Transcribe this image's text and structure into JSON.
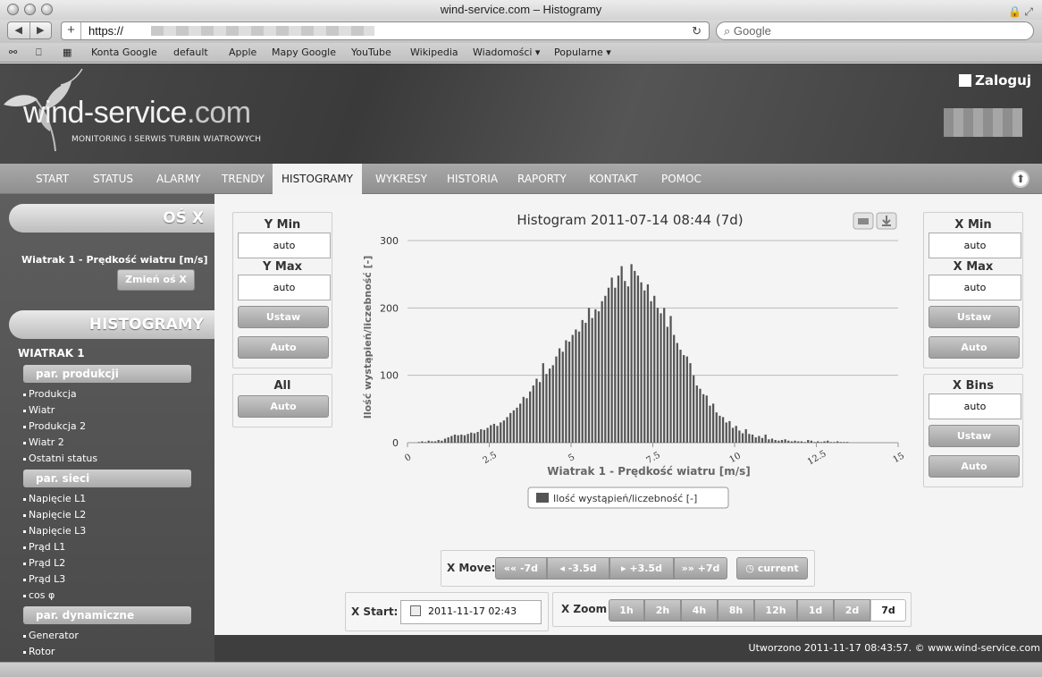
{
  "window": {
    "title": "wind-service.com – Histogramy"
  },
  "browser": {
    "url_prefix": "https://",
    "search_placeholder": "Google",
    "bookmarks": [
      "Konta Google",
      "default",
      "Apple",
      "Mapy Google",
      "YouTube",
      "Wikipedia",
      "Wiadomości ▾",
      "Popularne ▾"
    ]
  },
  "site": {
    "logo_main": "wind-service",
    "logo_tld": ".com",
    "tagline": "MONITORING I SERWIS TURBIN WIATROWYCH",
    "login": "Zaloguj"
  },
  "nav": {
    "items": [
      "START",
      "STATUS",
      "ALARMY",
      "TRENDY",
      "HISTOGRAMY",
      "WYKRESY",
      "HISTORIA",
      "RAPORTY",
      "KONTAKT",
      "POMOC"
    ],
    "active": "HISTOGRAMY"
  },
  "sidebar": {
    "axis_title": "OŚ X",
    "axis_value": "Wiatrak 1 - Prędkość wiatru [m/s]",
    "change_axis": "Zmień oś X",
    "histograms_title": "HISTOGRAMY",
    "turbine": "WIATRAK 1",
    "groups": [
      {
        "label": "par. produkcji",
        "items": [
          "Produkcja",
          "Wiatr",
          "Produkcja 2",
          "Wiatr 2",
          "Ostatni status"
        ]
      },
      {
        "label": "par. sieci",
        "items": [
          "Napięcie L1",
          "Napięcie L2",
          "Napięcie L3",
          "Prąd L1",
          "Prąd L2",
          "Prąd L3",
          "cos φ"
        ]
      },
      {
        "label": "par. dynamiczne",
        "items": [
          "Generator",
          "Rotor"
        ]
      }
    ]
  },
  "left_panel": {
    "ymin_label": "Y Min",
    "ymin_value": "auto",
    "ymax_label": "Y Max",
    "ymax_value": "auto",
    "set": "Ustaw",
    "auto": "Auto",
    "all_label": "All",
    "all_auto": "Auto"
  },
  "right_panel": {
    "xmin_label": "X Min",
    "xmin_value": "auto",
    "xmax_label": "X Max",
    "xmax_value": "auto",
    "set": "Ustaw",
    "auto": "Auto",
    "xbins_label": "X Bins",
    "xbins_value": "auto",
    "bins_set": "Ustaw",
    "bins_auto": "Auto"
  },
  "chart_data": {
    "type": "bar",
    "title": "Histogram 2011-07-14 08:44 (7d)",
    "xlabel": "Wiatrak 1 - Prędkość wiatru [m/s]",
    "ylabel": "Ilość wystąpień/liczebność [-]",
    "legend": "Ilość wystąpień/liczebność [-]",
    "legend_position": "bottom",
    "xlim": [
      0,
      15
    ],
    "ylim": [
      0,
      300
    ],
    "xticks": [
      "0",
      "2.5",
      "5",
      "7.5",
      "10",
      "12.5",
      "15"
    ],
    "yticks": [
      "0",
      "100",
      "200",
      "300"
    ],
    "grid": true,
    "bin_width": 0.1,
    "x_start": 0.3,
    "values": [
      1,
      2,
      1,
      3,
      2,
      2,
      4,
      3,
      6,
      8,
      10,
      12,
      11,
      12,
      11,
      13,
      15,
      14,
      16,
      20,
      19,
      22,
      26,
      28,
      25,
      30,
      33,
      38,
      44,
      48,
      52,
      58,
      68,
      66,
      76,
      85,
      95,
      90,
      118,
      102,
      110,
      115,
      128,
      140,
      135,
      152,
      150,
      160,
      168,
      165,
      182,
      178,
      200,
      185,
      198,
      195,
      210,
      218,
      230,
      245,
      230,
      248,
      262,
      240,
      232,
      265,
      255,
      248,
      238,
      226,
      235,
      210,
      218,
      200,
      192,
      200,
      172,
      188,
      160,
      148,
      138,
      130,
      128,
      118,
      100,
      85,
      80,
      72,
      70,
      55,
      58,
      45,
      40,
      38,
      30,
      32,
      22,
      25,
      18,
      14,
      20,
      13,
      12,
      8,
      10,
      7,
      12,
      5,
      6,
      4,
      3,
      4,
      5,
      3,
      2,
      3,
      2,
      2,
      1,
      4,
      3,
      1,
      2,
      1,
      2,
      3,
      1,
      1,
      2,
      1,
      1,
      1
    ]
  },
  "x_move": {
    "label": "X Move:",
    "buttons": [
      "«« -7d",
      "◂ -3.5d",
      "▸ +3.5d",
      "»» +7d"
    ],
    "current": "current"
  },
  "x_start": {
    "label": "X Start:",
    "value": "2011-11-17 02:43"
  },
  "x_zoom": {
    "label": "X Zoom",
    "buttons": [
      "1h",
      "2h",
      "4h",
      "8h",
      "12h",
      "1d",
      "2d",
      "7d"
    ],
    "selected": "7d"
  },
  "footer": {
    "text": "Utworzono 2011-11-17 08:43:57. © www.wind-service.com"
  }
}
